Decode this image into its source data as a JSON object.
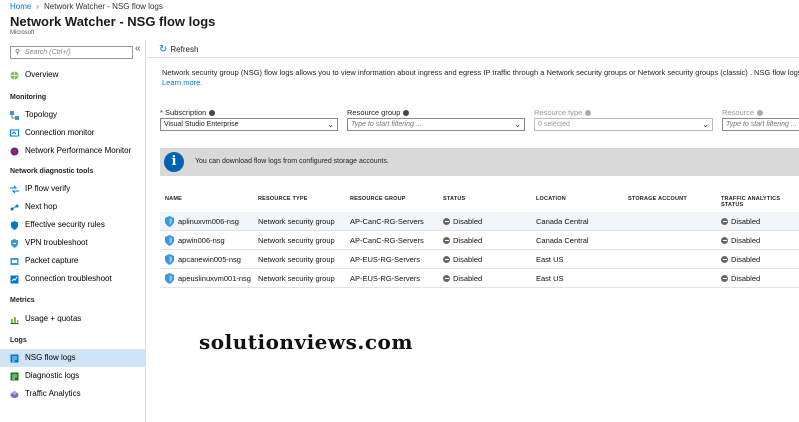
{
  "breadcrumb": {
    "home": "Home",
    "current": "Network Watcher - NSG flow logs"
  },
  "blade": {
    "title": "Network Watcher - NSG flow logs",
    "subtitle": "Microsoft"
  },
  "sidebar": {
    "search_placeholder": "Search (Ctrl+/)",
    "collapse": "«",
    "overview": "Overview",
    "sections": {
      "monitoring": "Monitoring",
      "diagnostic": "Network diagnostic tools",
      "metrics": "Metrics",
      "logs": "Logs"
    },
    "items": {
      "topology": "Topology",
      "connection_monitor": "Connection monitor",
      "npm": "Network Performance Monitor",
      "ip_flow": "IP flow verify",
      "next_hop": "Next hop",
      "effective_rules": "Effective security rules",
      "vpn": "VPN troubleshoot",
      "packet": "Packet capture",
      "conn_trouble": "Connection troubleshoot",
      "usage": "Usage + quotas",
      "nsg_logs": "NSG flow logs",
      "diag_logs": "Diagnostic logs",
      "traffic": "Traffic Analytics"
    }
  },
  "toolbar": {
    "refresh": "Refresh"
  },
  "description": {
    "text": "Network security group (NSG) flow logs allows you to view information about ingress and egress IP traffic through a Network security groups or Network security groups (classic) . NSG flow logs do not",
    "learn_more": "Learn more."
  },
  "filters": {
    "subscription_label": "Subscription",
    "subscription_value": "Visual Studio Enterprise",
    "resource_group_label": "Resource group",
    "resource_group_placeholder": "Type to start filtering ...",
    "resource_type_label": "Resource type",
    "resource_type_value": "0 selected",
    "resource_label": "Resource",
    "resource_placeholder": "Type to start filtering ..."
  },
  "banner": {
    "text": "You can download flow logs from configured storage accounts."
  },
  "table": {
    "headers": [
      "NAME",
      "RESOURCE TYPE",
      "RESOURCE GROUP",
      "STATUS",
      "LOCATION",
      "STORAGE ACCOUNT",
      "TRAFFIC ANALYTICS STATUS"
    ],
    "rows": [
      {
        "name": "aplinuxvm006-nsg",
        "type": "Network security group",
        "group": "AP-CanC-RG-Servers",
        "status": "Disabled",
        "location": "Canada Central",
        "storage": "",
        "traffic": "Disabled"
      },
      {
        "name": "apwin006-nsg",
        "type": "Network security group",
        "group": "AP-CanC-RG-Servers",
        "status": "Disabled",
        "location": "Canada Central",
        "storage": "",
        "traffic": "Disabled"
      },
      {
        "name": "apcanewin005-nsg",
        "type": "Network security group",
        "group": "AP-EUS-RG-Servers",
        "status": "Disabled",
        "location": "East US",
        "storage": "",
        "traffic": "Disabled"
      },
      {
        "name": "apeuslinuxvm001-nsg",
        "type": "Network security group",
        "group": "AP-EUS-RG-Servers",
        "status": "Disabled",
        "location": "East US",
        "storage": "",
        "traffic": "Disabled"
      }
    ]
  },
  "watermark": "solutionviews.com",
  "colors": {
    "accent": "#0078d4",
    "selected": "#cfe4f7",
    "banner": "#d9d9d9"
  }
}
